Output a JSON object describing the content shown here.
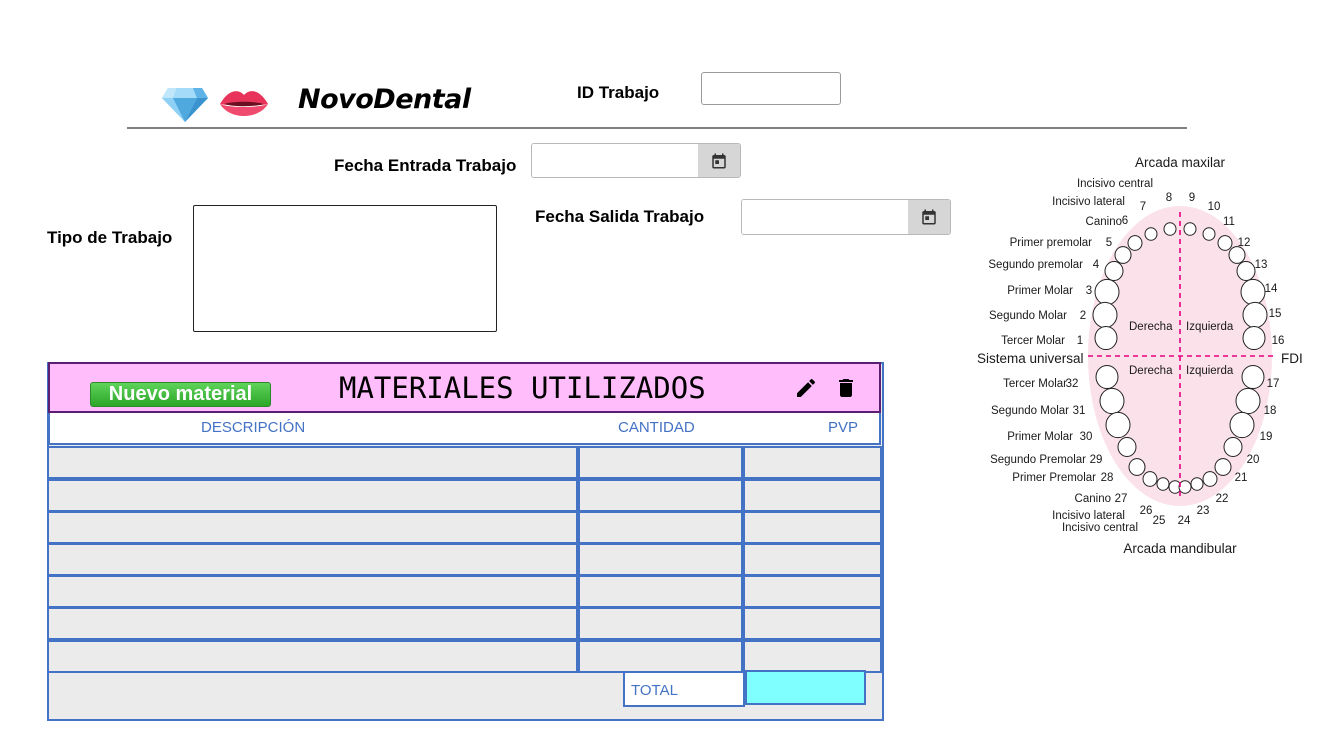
{
  "header": {
    "brand": "NovoDental",
    "id_label": "ID Trabajo",
    "id_value": ""
  },
  "form": {
    "fecha_entrada_label": "Fecha Entrada Trabajo",
    "fecha_entrada_value": "",
    "fecha_salida_label": "Fecha Salida Trabajo",
    "fecha_salida_value": "",
    "tipo_label": "Tipo de Trabajo",
    "tipo_value": ""
  },
  "materials": {
    "new_button": "Nuevo material",
    "title": "MATERIALES UTILIZADOS",
    "columns": [
      "DESCRIPCIÓN",
      "CANTIDAD",
      "PVP"
    ],
    "rows": [
      {
        "descripcion": "",
        "cantidad": "",
        "pvp": ""
      },
      {
        "descripcion": "",
        "cantidad": "",
        "pvp": ""
      },
      {
        "descripcion": "",
        "cantidad": "",
        "pvp": ""
      },
      {
        "descripcion": "",
        "cantidad": "",
        "pvp": ""
      },
      {
        "descripcion": "",
        "cantidad": "",
        "pvp": ""
      },
      {
        "descripcion": "",
        "cantidad": "",
        "pvp": ""
      },
      {
        "descripcion": "",
        "cantidad": "",
        "pvp": ""
      }
    ],
    "total_label": "TOTAL",
    "total_value": ""
  },
  "dental_chart": {
    "arcada_maxilar": "Arcada maxilar",
    "arcada_mandibular": "Arcada mandibular",
    "sistema_universal": "Sistema universal",
    "fdi": "FDI",
    "derecha": "Derecha",
    "izquierda": "Izquierda",
    "upper_left_labels": [
      "Incisivo central",
      "Incisivo lateral",
      "Canino",
      "Primer premolar",
      "Segundo premolar",
      "Primer Molar",
      "Segundo Molar",
      "Tercer Molar"
    ],
    "upper_left_numbers": [
      "8",
      "7",
      "6",
      "5",
      "4",
      "3",
      "2",
      "1"
    ],
    "upper_right_numbers": [
      "9",
      "10",
      "11",
      "12",
      "13",
      "14",
      "15",
      "16"
    ],
    "lower_left_labels": [
      "Tercer Molar",
      "Segundo Molar",
      "Primer Molar",
      "Segundo Premolar",
      "Primer Premolar",
      "Canino",
      "Incisivo lateral",
      "Incisivo central"
    ],
    "lower_left_numbers": [
      "32",
      "31",
      "30",
      "29",
      "28",
      "27",
      "26",
      "25"
    ],
    "lower_right_numbers": [
      "17",
      "18",
      "19",
      "20",
      "21",
      "22",
      "23",
      "24"
    ]
  },
  "colors": {
    "accent_blue": "#4472c4",
    "header_pink": "#ffbdfb",
    "total_cyan": "#7fffff",
    "midline_magenta": "#e6007e"
  }
}
